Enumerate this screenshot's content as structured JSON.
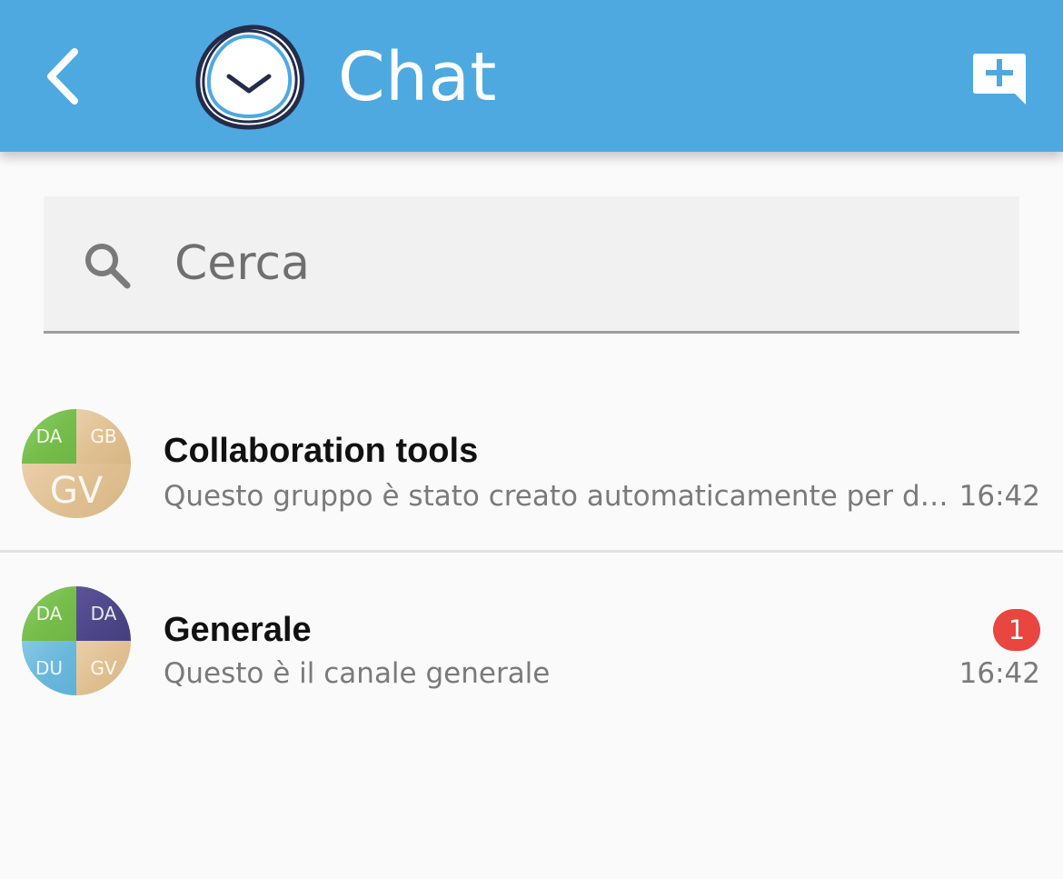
{
  "header": {
    "title": "Chat",
    "back_icon": "back-arrow-icon",
    "logo": "app-logo",
    "new_chat_icon": "new-chat-icon",
    "color": "#4ea9e0"
  },
  "search": {
    "placeholder": "Cerca",
    "value": ""
  },
  "chats": [
    {
      "name": "Collaboration tools",
      "preview": "Questo gruppo è stato creato automaticamente per d…",
      "time": "16:42",
      "avatar": {
        "top_left": "DA",
        "top_right": "GB",
        "bottom": "GV"
      }
    },
    {
      "name": "Generale",
      "preview": "Questo è il canale generale",
      "time": "16:42",
      "unread": "1",
      "avatar": {
        "top_left": "DA",
        "top_right": "DA",
        "bottom_left": "DU",
        "bottom_right": "GV"
      }
    }
  ],
  "colors": {
    "badge": "#e8463f",
    "avatar_green": "#7dc353",
    "avatar_tan": "#e1c395",
    "avatar_purple": "#514a8b",
    "avatar_blue": "#70badf"
  }
}
